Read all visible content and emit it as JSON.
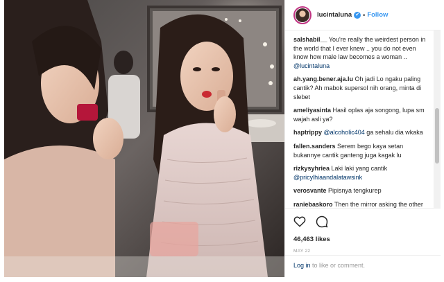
{
  "post": {
    "username": "lucintaluna",
    "verified_glyph": "✔",
    "separator": "•",
    "follow_label": "Follow",
    "likes": "46,463 likes",
    "date": "MAY 22"
  },
  "comments": [
    {
      "author": "salshabil__",
      "text": " You're really the weirdest person in the world that I ever knew .. you do not even know how male law becomes a woman .. ",
      "mention": "@lucintaluna",
      "tail": ""
    },
    {
      "author": "ah.yang.bener.aja.lu",
      "text": " Oh jadi Lo ngaku paling cantik? Ah mabok supersol nih orang, minta di slebet",
      "mention": "",
      "tail": ""
    },
    {
      "author": "ameliyasinta",
      "text": " Hasil oplas aja songong, lupa sm wajah asli ya?",
      "mention": "",
      "tail": ""
    },
    {
      "author": "haptrippy",
      "text": " ",
      "mention": "@alcoholic404",
      "tail": " ga sehalu dia wkaka"
    },
    {
      "author": "fallen.sanders",
      "text": " Serem bego kaya setan bukannye cantik ganteng juga kagak lu",
      "mention": "",
      "tail": ""
    },
    {
      "author": "rizkysyhriea",
      "text": " Laki laki yang cantik ",
      "mention": "@pricylhiaandalatawsink",
      "tail": ""
    },
    {
      "author": "verosvante",
      "text": " Pipisnya tengkurep",
      "mention": "",
      "tail": ""
    },
    {
      "author": "raniebaskoro",
      "text": " Then the mirror asking the other question to her Mirror : enak ga di sumpahin orang banyak ? Wkwkwkk ( at",
      "mention": "",
      "tail": ""
    }
  ],
  "footer": {
    "login_link": "Log in",
    "login_text": " to like or comment."
  },
  "icons": {
    "like": "heart-icon",
    "comment": "comment-icon"
  },
  "colors": {
    "accent": "#3897f0",
    "link": "#003569",
    "avatar_ring": "#c13584"
  }
}
